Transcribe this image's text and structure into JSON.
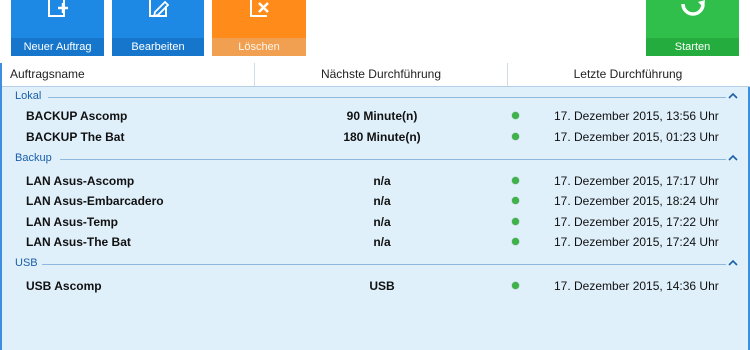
{
  "toolbar": {
    "buttons": [
      {
        "label": "Neuer Auftrag",
        "icon": "new-task-icon",
        "color": "#1e88e5"
      },
      {
        "label": "Bearbeiten",
        "icon": "edit-icon",
        "color": "#1e88e5"
      },
      {
        "label": "Löschen",
        "icon": "delete-icon",
        "color": "#ff8c1a"
      },
      {
        "label": "Starten",
        "icon": "refresh-icon",
        "color": "#2fbf4a"
      }
    ]
  },
  "table": {
    "columns": [
      "Auftragsname",
      "Nächste Durchführung",
      "Letzte Durchführung"
    ],
    "groups": [
      {
        "title": "Lokal",
        "rows": [
          {
            "name": "BACKUP Ascomp",
            "next": "90 Minute(n)",
            "status": "green",
            "last": "17. Dezember 2015, 13:56 Uhr"
          },
          {
            "name": "BACKUP The Bat",
            "next": "180 Minute(n)",
            "status": "green",
            "last": "17. Dezember 2015, 01:23 Uhr"
          }
        ]
      },
      {
        "title": "Backup",
        "rows": [
          {
            "name": "LAN Asus-Ascomp",
            "next": "n/a",
            "status": "green",
            "last": "17. Dezember 2015, 17:17 Uhr"
          },
          {
            "name": "LAN Asus-Embarcadero",
            "next": "n/a",
            "status": "green",
            "last": "17. Dezember 2015, 18:24 Uhr"
          },
          {
            "name": "LAN Asus-Temp",
            "next": "n/a",
            "status": "green",
            "last": "17. Dezember 2015, 17:22 Uhr"
          },
          {
            "name": "LAN Asus-The Bat",
            "next": "n/a",
            "status": "green",
            "last": "17. Dezember 2015, 17:24 Uhr"
          }
        ]
      },
      {
        "title": "USB",
        "rows": [
          {
            "name": "USB Ascomp",
            "next": "USB",
            "status": "green",
            "last": "17. Dezember 2015, 14:36 Uhr"
          }
        ]
      }
    ]
  }
}
